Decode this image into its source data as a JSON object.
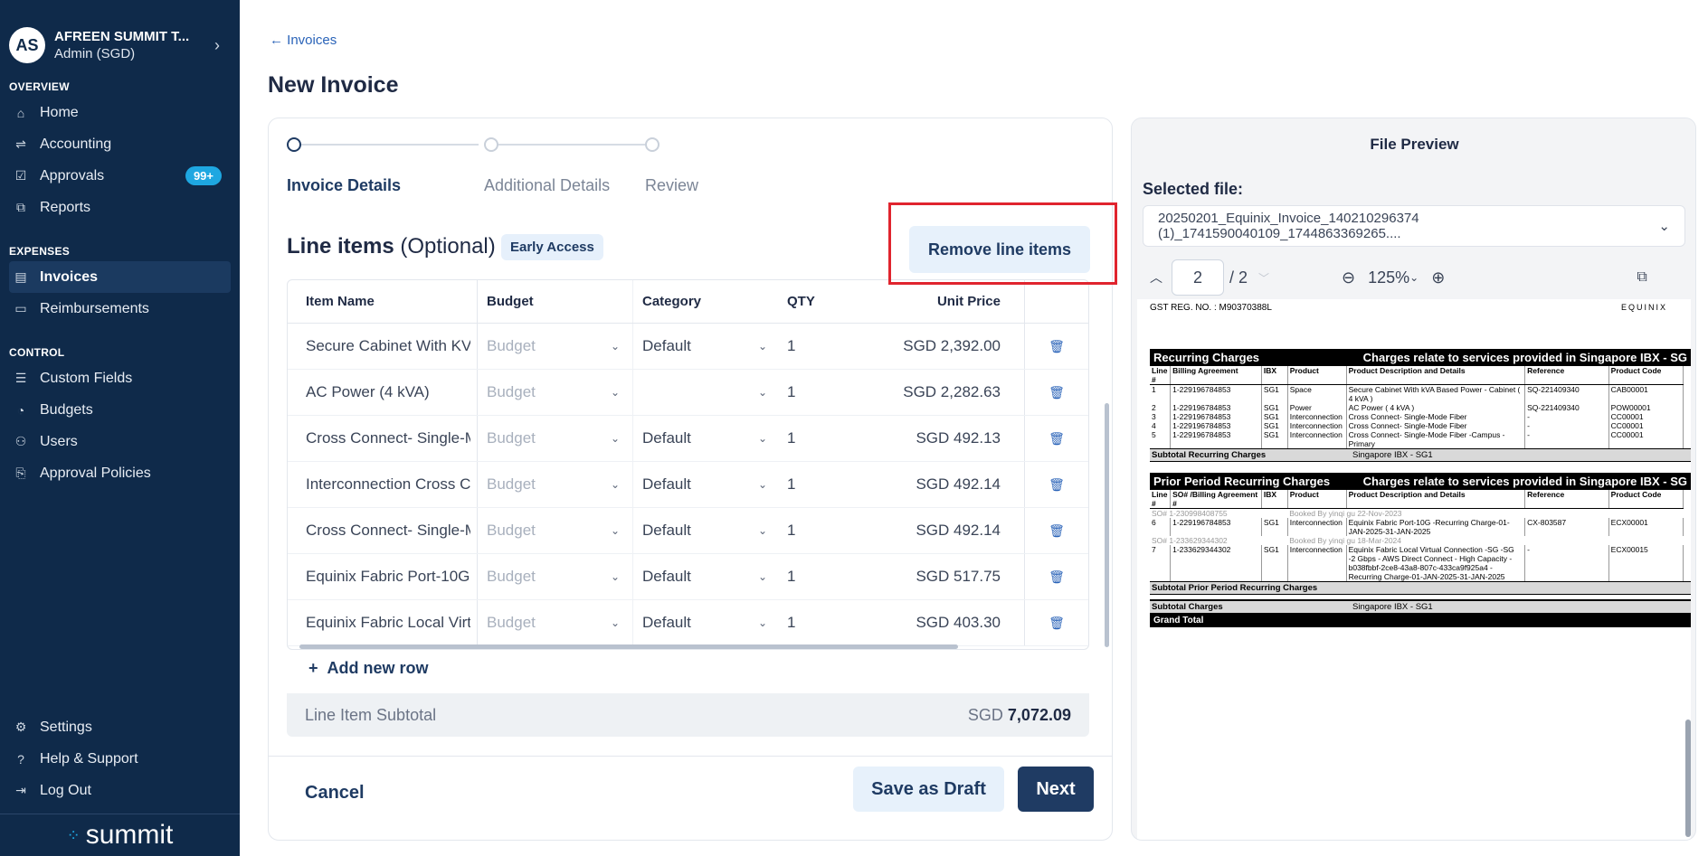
{
  "sidebar": {
    "avatar": "AS",
    "org_name": "AFREEN SUMMIT T...",
    "role": "Admin (SGD)",
    "sections": [
      {
        "label": "OVERVIEW"
      },
      {
        "label": "EXPENSES"
      },
      {
        "label": "CONTROL"
      }
    ],
    "overview": [
      {
        "label": "Home"
      },
      {
        "label": "Accounting"
      },
      {
        "label": "Approvals",
        "badge": "99+"
      },
      {
        "label": "Reports"
      }
    ],
    "expenses": [
      {
        "label": "Invoices"
      },
      {
        "label": "Reimbursements"
      }
    ],
    "control": [
      {
        "label": "Custom Fields"
      },
      {
        "label": "Budgets"
      },
      {
        "label": "Users"
      },
      {
        "label": "Approval Policies"
      }
    ],
    "bottom": [
      {
        "label": "Settings"
      },
      {
        "label": "Help & Support"
      },
      {
        "label": "Log Out"
      }
    ],
    "brand": "summit"
  },
  "header": {
    "back_link": "Invoices",
    "title": "New Invoice"
  },
  "stepper": {
    "steps": [
      "Invoice Details",
      "Additional Details",
      "Review"
    ]
  },
  "line_items": {
    "title": "Line items",
    "optional": "(Optional)",
    "early_access": "Early Access",
    "remove_button": "Remove line items",
    "columns": [
      "Item Name",
      "Budget",
      "Category",
      "QTY",
      "Unit Price"
    ],
    "budget_placeholder": "Budget",
    "rows": [
      {
        "name": "Secure Cabinet With KVA Based Power",
        "category": "Default",
        "qty": "1",
        "price": "SGD 2,392.00"
      },
      {
        "name": "AC Power (4 kVA)",
        "category": "",
        "qty": "1",
        "price": "SGD 2,282.63"
      },
      {
        "name": "Cross Connect- Single-Mode Fiber",
        "category": "Default",
        "qty": "1",
        "price": "SGD 492.13"
      },
      {
        "name": "Interconnection Cross Connect",
        "category": "Default",
        "qty": "1",
        "price": "SGD 492.14"
      },
      {
        "name": "Cross Connect- Single-Mode Fiber",
        "category": "Default",
        "qty": "1",
        "price": "SGD 492.14"
      },
      {
        "name": "Equinix Fabric Port-10G",
        "category": "Default",
        "qty": "1",
        "price": "SGD 517.75"
      },
      {
        "name": "Equinix Fabric Local Virtual Connection",
        "category": "Default",
        "qty": "1",
        "price": "SGD 403.30"
      }
    ],
    "add_row": "Add new row",
    "subtotal_label": "Line Item Subtotal",
    "subtotal_currency": "SGD",
    "subtotal_value": "7,072.09"
  },
  "actions": {
    "cancel": "Cancel",
    "save_draft": "Save as Draft",
    "next": "Next"
  },
  "preview": {
    "title": "File Preview",
    "selected_label": "Selected file:",
    "file_name": "20250201_Equinix_Invoice_140210296374 (1)_1741590040109_1744863369265....",
    "page": "2",
    "page_total": "/ 2",
    "zoom": "125%",
    "doc": {
      "gst": "GST REG. NO. : M90370388L",
      "logo": "EQUINIX",
      "recurring_title": "Recurring Charges",
      "recurring_note": "Charges relate to services provided in Singapore IBX - SG",
      "headers": [
        "Line #",
        "Billing Agreement",
        "IBX",
        "Product",
        "Product Description and Details",
        "Reference",
        "Product Code"
      ],
      "recurring_rows": [
        [
          "1",
          "1-229196784853",
          "SG1",
          "Space",
          "Secure Cabinet With kVA Based Power - Cabinet ( 4 kVA )",
          "SQ-221409340",
          "CAB00001"
        ],
        [
          "2",
          "1-229196784853",
          "SG1",
          "Power",
          "AC Power ( 4 kVA )",
          "SQ-221409340",
          "POW00001"
        ],
        [
          "3",
          "1-229196784853",
          "SG1",
          "Interconnection",
          "Cross Connect- Single-Mode Fiber",
          "-",
          "CC00001"
        ],
        [
          "4",
          "1-229196784853",
          "SG1",
          "Interconnection",
          "Cross Connect- Single-Mode Fiber",
          "-",
          "CC00001"
        ],
        [
          "5",
          "1-229196784853",
          "SG1",
          "Interconnection",
          "Cross Connect- Single-Mode Fiber -Campus - Primary",
          "-",
          "CC00001"
        ]
      ],
      "subtotal_recurring": "Subtotal Recurring Charges",
      "subtotal_recurring_loc": "Singapore IBX - SG1",
      "prior_title": "Prior Period Recurring Charges",
      "prior_note": "Charges relate to services provided in Singapore IBX - SG",
      "prior_headers": [
        "Line #",
        "SO# /Billing Agreement #",
        "IBX",
        "Product",
        "Product Description and Details",
        "Reference",
        "Product Code"
      ],
      "so1": "SO# 1-230998408755",
      "booked1": "Booked By yinqi gu 22-Nov-2023",
      "prior_row1": [
        "6",
        "1-229196784853",
        "SG1",
        "Interconnection",
        "Equinix Fabric Port-10G -Recurring Charge-01-JAN-2025-31-JAN-2025",
        "CX-803587",
        "ECX00001"
      ],
      "so2": "SO# 1-233629344302",
      "booked2": "Booked By yinqi gu 18-Mar-2024",
      "prior_row2": [
        "7",
        "1-233629344302",
        "SG1",
        "Interconnection",
        "Equinix Fabric Local Virtual Connection -SG -SG -2 Gbps - AWS Direct Connect - High Capacity - b038fbbf-2ce8-43a8-807c-433ca9f925a4 - Recurring Charge-01-JAN-2025-31-JAN-2025",
        "-",
        "ECX00015"
      ],
      "subtotal_prior": "Subtotal Prior Period Recurring Charges",
      "subtotal_charges": "Subtotal Charges",
      "subtotal_charges_loc": "Singapore IBX - SG1",
      "grand_total": "Grand Total"
    }
  }
}
